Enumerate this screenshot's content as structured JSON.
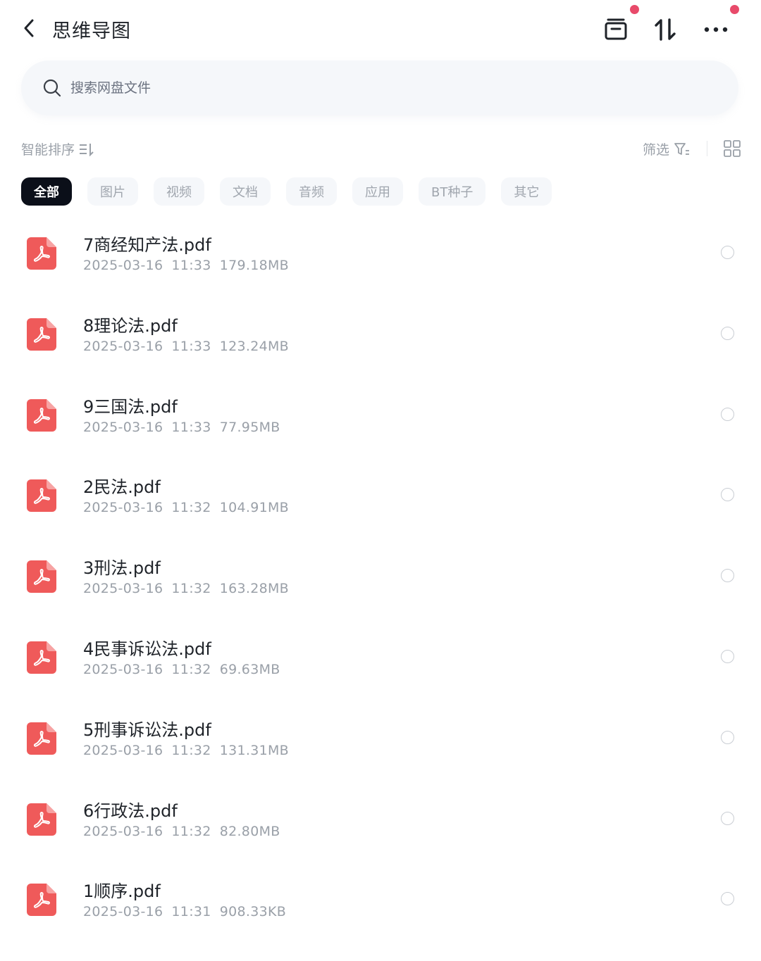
{
  "header": {
    "title": "思维导图"
  },
  "search": {
    "placeholder": "搜索网盘文件"
  },
  "toolbar": {
    "sort_label": "智能排序",
    "filter_label": "筛选"
  },
  "tabs": [
    {
      "label": "全部",
      "active": true
    },
    {
      "label": "图片"
    },
    {
      "label": "视频"
    },
    {
      "label": "文档"
    },
    {
      "label": "音频"
    },
    {
      "label": "应用"
    },
    {
      "label": "BT种子"
    },
    {
      "label": "其它"
    }
  ],
  "files": [
    {
      "name": "7商经知产法.pdf",
      "date": "2025-03-16",
      "time": "11:33",
      "size": "179.18MB"
    },
    {
      "name": "8理论法.pdf",
      "date": "2025-03-16",
      "time": "11:33",
      "size": "123.24MB"
    },
    {
      "name": "9三国法.pdf",
      "date": "2025-03-16",
      "time": "11:33",
      "size": "77.95MB"
    },
    {
      "name": "2民法.pdf",
      "date": "2025-03-16",
      "time": "11:32",
      "size": "104.91MB"
    },
    {
      "name": "3刑法.pdf",
      "date": "2025-03-16",
      "time": "11:32",
      "size": "163.28MB"
    },
    {
      "name": "4民事诉讼法.pdf",
      "date": "2025-03-16",
      "time": "11:32",
      "size": "69.63MB"
    },
    {
      "name": "5刑事诉讼法.pdf",
      "date": "2025-03-16",
      "time": "11:32",
      "size": "131.31MB"
    },
    {
      "name": "6行政法.pdf",
      "date": "2025-03-16",
      "time": "11:32",
      "size": "82.80MB"
    },
    {
      "name": "1顺序.pdf",
      "date": "2025-03-16",
      "time": "11:31",
      "size": "908.33KB"
    }
  ],
  "icons": {
    "back": "chevron-left-icon",
    "archive": "archive-box-icon",
    "sort": "sort-arrows-icon",
    "more": "more-dots-icon",
    "search": "search-icon",
    "sort_mode": "sort-lines-icon",
    "filter": "filter-funnel-icon",
    "grid": "grid-view-icon",
    "file": "pdf-file-icon"
  },
  "colors": {
    "accent_dot": "#e84a6a",
    "pdf_red": "#ef5a5a",
    "active_tab": "#0b0f19"
  }
}
